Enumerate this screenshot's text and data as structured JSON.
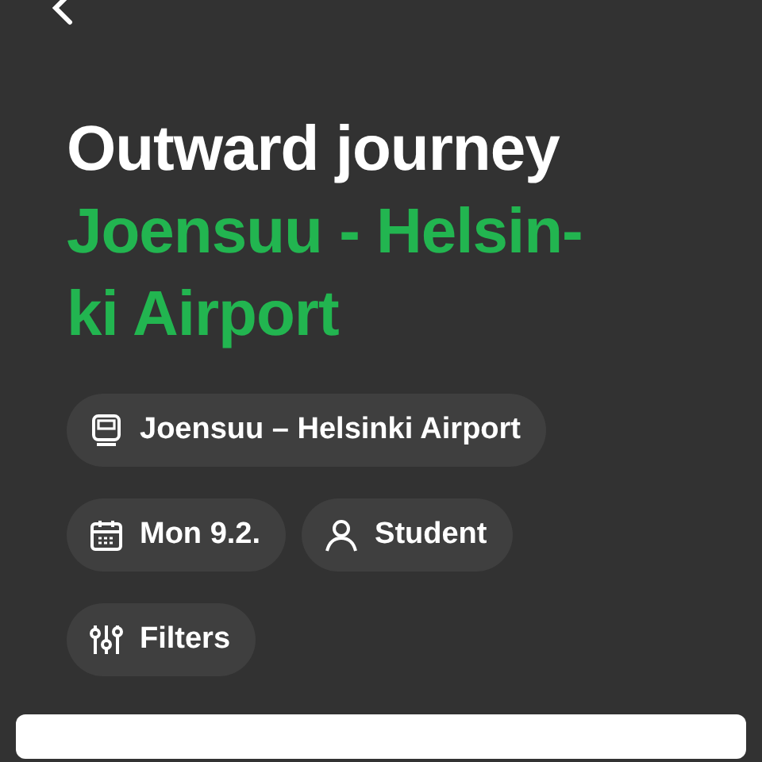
{
  "title": "Outward journey",
  "route_heading": "Joensuu - Helsin-ki Airport",
  "chips": [
    {
      "kind": "train",
      "label": "Joensuu – Helsinki Airport"
    },
    {
      "kind": "calendar",
      "label": "Mon 9.2."
    },
    {
      "kind": "person",
      "label": "Student"
    },
    {
      "kind": "filters",
      "label": "Filters"
    }
  ]
}
